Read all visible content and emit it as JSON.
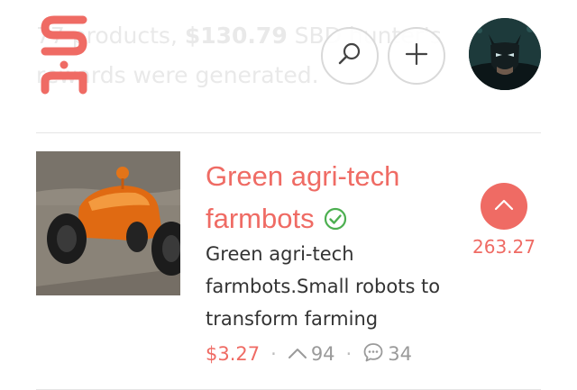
{
  "background_banner": {
    "line1_prefix": "77 products, ",
    "line1_amount": "$130.79",
    "line1_suffix": " SBD hunter's",
    "line2": "rewards were generated."
  },
  "header": {
    "logo_text": "sh",
    "search_icon": "search-icon",
    "add_icon": "plus-icon",
    "avatar_icon": "user-avatar"
  },
  "post": {
    "title": "Green agri-tech farmbots",
    "verified_icon": "check-circle-icon",
    "description": "Green agri-tech farmbots.Small robots to transform farming",
    "payout": "$3.27",
    "upvotes": "94",
    "comments": "34",
    "vote_score": "263.27"
  },
  "colors": {
    "accent": "#ef6b64",
    "verified": "#4caf50",
    "muted": "#9a9a9a",
    "divider": "#e5e5e5"
  }
}
